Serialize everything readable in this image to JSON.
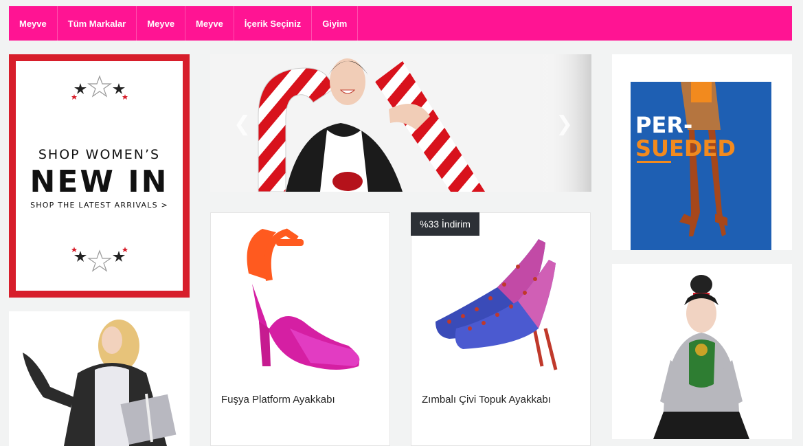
{
  "nav": {
    "items": [
      {
        "label": "Meyve"
      },
      {
        "label": "Tüm Markalar"
      },
      {
        "label": "Meyve"
      },
      {
        "label": "Meyve"
      },
      {
        "label": "İçerik Seçiniz"
      },
      {
        "label": "Giyim"
      }
    ]
  },
  "promo_left": {
    "line1": "SHOP WOMEN’S",
    "line2": "NEW IN",
    "line3": "SHOP THE LATEST ARRIVALS >"
  },
  "slider": {
    "prev_icon": "chevron-left-icon",
    "next_icon": "chevron-right-icon"
  },
  "products": [
    {
      "title": "Fuşya Platform Ayakkabı"
    },
    {
      "title": "Zımbalı Çivi Topuk Ayakkabı",
      "badge": "%33 İndirim"
    }
  ],
  "ad_right": {
    "line1": "PER-",
    "line2": "SUEDED"
  },
  "colors": {
    "nav_bg": "#ff1493",
    "promo_border": "#d71e2b",
    "badge_bg": "#2c3036",
    "ad_blue": "#1e5fb3",
    "ad_orange": "#f28a1e"
  }
}
